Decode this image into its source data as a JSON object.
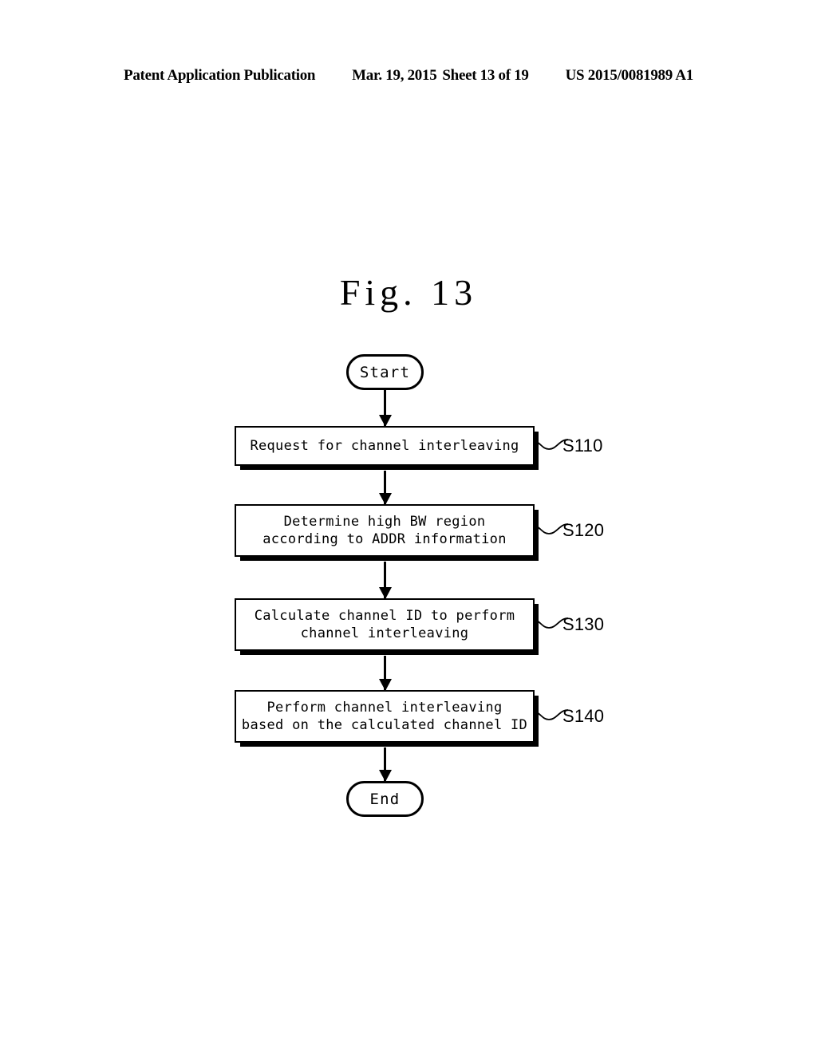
{
  "page": {
    "header": {
      "publication": "Patent Application Publication",
      "date": "Mar. 19, 2015",
      "sheet": "Sheet 13 of 19",
      "pub_number": "US 2015/0081989 A1"
    },
    "figure_title": "Fig.  13"
  },
  "flowchart": {
    "start_label": "Start",
    "end_label": "End",
    "steps": [
      {
        "ref": "S110",
        "lines": [
          "Request for channel interleaving"
        ]
      },
      {
        "ref": "S120",
        "lines": [
          "Determine high BW region",
          "according to ADDR information"
        ]
      },
      {
        "ref": "S130",
        "lines": [
          "Calculate channel ID to perform",
          "channel interleaving"
        ]
      },
      {
        "ref": "S140",
        "lines": [
          "Perform channel interleaving",
          "based on the calculated channel ID"
        ]
      }
    ]
  }
}
